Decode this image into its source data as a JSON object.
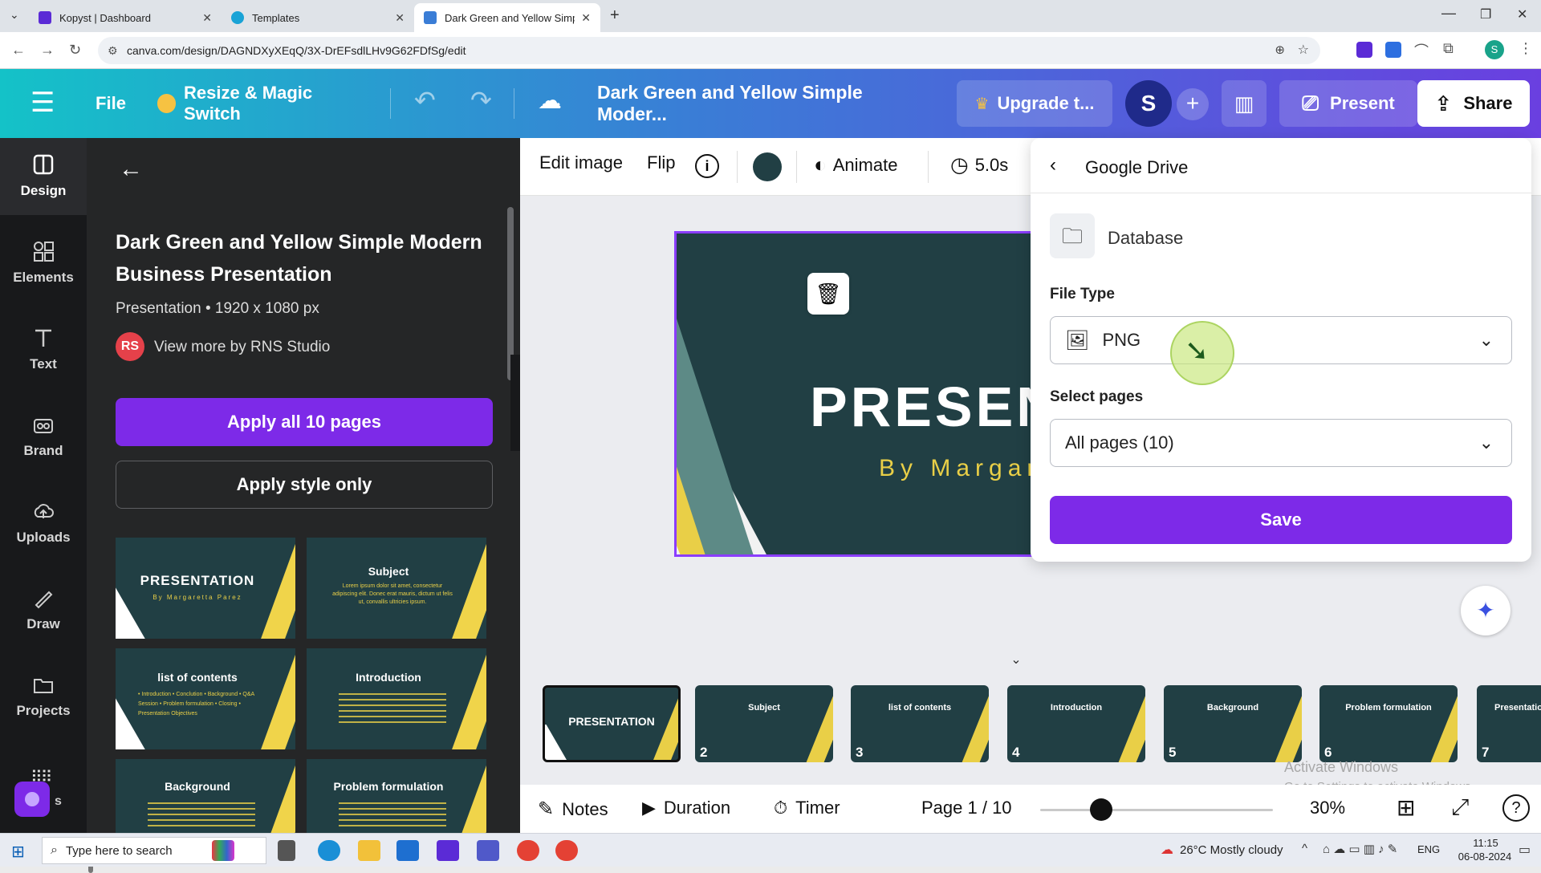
{
  "browser": {
    "tabs": [
      {
        "label": "Kopyst | Dashboard",
        "active": false
      },
      {
        "label": "Templates",
        "active": false
      },
      {
        "label": "Dark Green and Yellow Simple Mod",
        "active": true
      }
    ],
    "url": "canva.com/design/DAGNDXyXEqQ/3X-DrEFsdlLHv9G62FDfSg/edit"
  },
  "header": {
    "file_label": "File",
    "resize_label": "Resize & Magic Switch",
    "doc_title": "Dark Green and Yellow Simple Moder...",
    "upgrade_label": "Upgrade t...",
    "avatar_letter": "S",
    "present_label": "Present",
    "share_label": "Share"
  },
  "rail": {
    "items": [
      {
        "label": "Design"
      },
      {
        "label": "Elements"
      },
      {
        "label": "Text"
      },
      {
        "label": "Brand"
      },
      {
        "label": "Uploads"
      },
      {
        "label": "Draw"
      },
      {
        "label": "Projects"
      }
    ],
    "apps_label": "s"
  },
  "panel": {
    "title": "Dark Green and Yellow Simple Modern Business Presentation",
    "meta": "Presentation • 1920 x 1080 px",
    "author_initials": "RS",
    "author_link": "View more by RNS Studio",
    "apply_all_label": "Apply all 10 pages",
    "apply_style_label": "Apply style only",
    "thumbs": [
      {
        "title": "PRESENTATION",
        "sub": "By Margaretta Parez"
      },
      {
        "title": "Subject",
        "sub": "Lorem ipsum dolor sit amet, consectetur adipiscing elit. Donec erat mauris, dictum ut felis ut, convallis ultricies ipsum."
      },
      {
        "title": "list of contents",
        "sub": "• Introduction  • Conclution  • Background  • Q&A Session  • Problem formulation  • Closing  • Presentation Objectives"
      },
      {
        "title": "Introduction",
        "sub": ""
      },
      {
        "title": "Background",
        "sub": ""
      },
      {
        "title": "Problem formulation",
        "sub": ""
      }
    ]
  },
  "toolbar": {
    "edit_image": "Edit image",
    "flip": "Flip",
    "animate": "Animate",
    "duration": "5.0s"
  },
  "canvas": {
    "title": "PRESEN",
    "subtitle": "By Margar"
  },
  "gdrive": {
    "title": "Google Drive",
    "folder": "Database",
    "file_type_label": "File Type",
    "file_type_value": "PNG",
    "select_pages_label": "Select pages",
    "select_pages_value": "All pages (10)",
    "save_label": "Save"
  },
  "pages": [
    {
      "num": "1",
      "title": "PRESENTATION"
    },
    {
      "num": "2",
      "title": "Subject"
    },
    {
      "num": "3",
      "title": "list of contents"
    },
    {
      "num": "4",
      "title": "Introduction"
    },
    {
      "num": "5",
      "title": "Background"
    },
    {
      "num": "6",
      "title": "Problem formulation"
    },
    {
      "num": "7",
      "title": "Presentatio"
    }
  ],
  "bottom": {
    "notes": "Notes",
    "duration": "Duration",
    "timer": "Timer",
    "page_indicator": "Page 1 / 10",
    "zoom": "30%",
    "zoom_level": 0.3
  },
  "watermark": {
    "line1": "Activate Windows",
    "line2": "Go to Settings to activate Windows."
  },
  "taskbar": {
    "search_placeholder": "Type here to search",
    "weather": "26°C  Mostly cloudy",
    "lang": "ENG",
    "time": "11:15",
    "date": "06-08-2024"
  },
  "colors": {
    "brand_purple": "#7d2ae8",
    "slide_green": "#213f44",
    "slide_yellow": "#f0d44a"
  }
}
